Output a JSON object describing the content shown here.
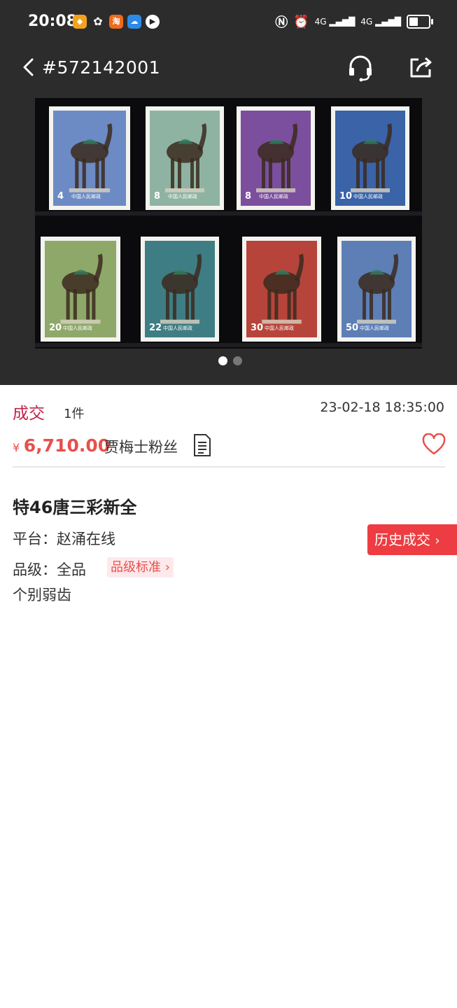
{
  "status_bar": {
    "time": "20:08",
    "signal_label_1": "4G",
    "signal_label_2": "4G"
  },
  "nav": {
    "title": "#572142001",
    "back_icon": "chevron-left-icon",
    "service_icon": "headset-icon",
    "share_icon": "share-icon"
  },
  "gallery": {
    "stamps_top": [
      {
        "value": "4",
        "color": "#6c8bc4"
      },
      {
        "value": "8",
        "color": "#8fb3a2"
      },
      {
        "value": "8",
        "color": "#7b4f9d"
      },
      {
        "value": "10",
        "color": "#3a63a8"
      }
    ],
    "stamps_bottom": [
      {
        "value": "20",
        "color": "#8ea86a"
      },
      {
        "value": "22",
        "color": "#3f7d84"
      },
      {
        "value": "30",
        "color": "#b7443a"
      },
      {
        "value": "50",
        "color": "#5d7fb6"
      }
    ],
    "stamp_caption": "中国人民邮政",
    "page_count": 2,
    "current_page": 1
  },
  "deal": {
    "status": "成交",
    "quantity": "1件",
    "datetime": "23-02-18 18:35:00",
    "currency": "¥",
    "price": "6,710.00",
    "buyer": "贾梅士粉丝",
    "colors": {
      "status": "#c0234b",
      "price": "#e8504b"
    }
  },
  "item": {
    "title": "特46唐三彩新全",
    "platform_label": "平台：",
    "platform": "赵涌在线",
    "grade_label": "品级：",
    "grade": "全品",
    "grade_standard": "品级标准",
    "note": "个别弱齿",
    "history_button": "历史成交"
  }
}
